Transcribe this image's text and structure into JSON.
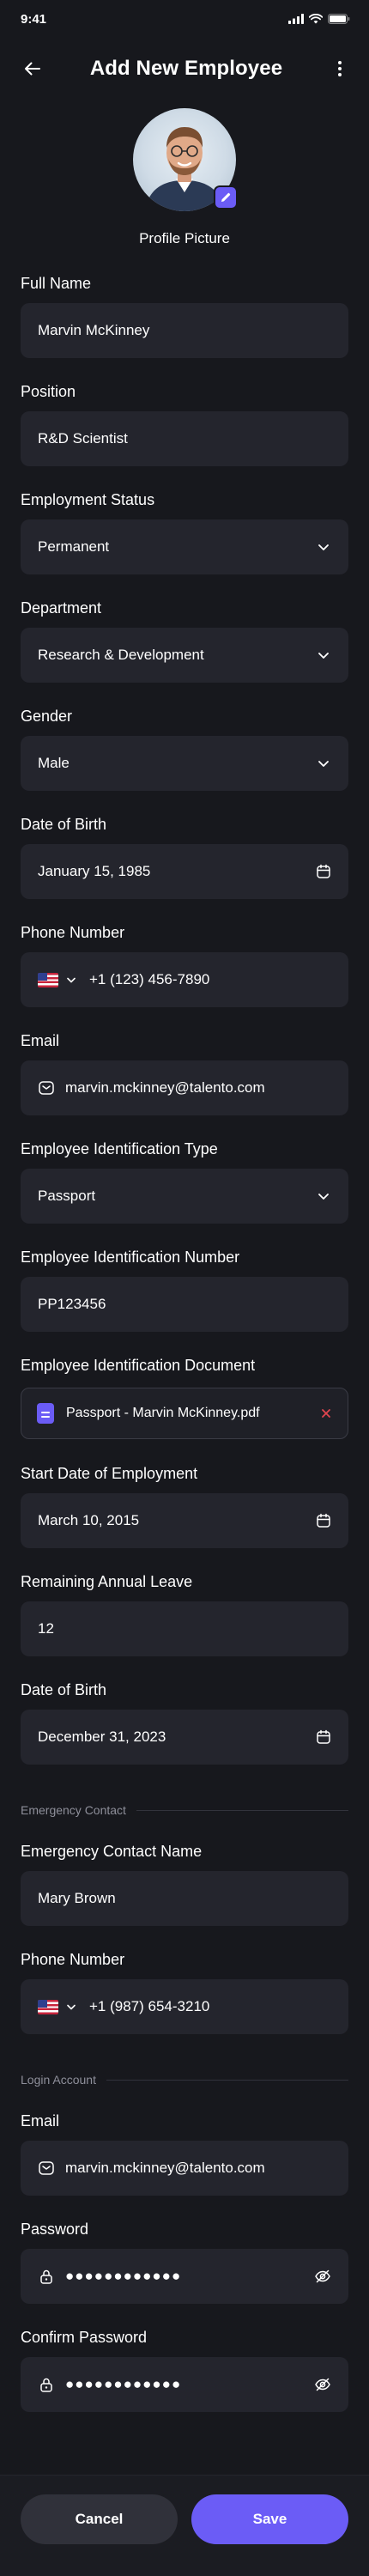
{
  "status_bar": {
    "time": "9:41"
  },
  "header": {
    "title": "Add New Employee"
  },
  "profile": {
    "caption": "Profile Picture"
  },
  "fields": {
    "full_name": {
      "label": "Full Name",
      "value": "Marvin McKinney"
    },
    "position": {
      "label": "Position",
      "value": "R&D Scientist"
    },
    "employment_status": {
      "label": "Employment Status",
      "value": "Permanent"
    },
    "department": {
      "label": "Department",
      "value": "Research & Development"
    },
    "gender": {
      "label": "Gender",
      "value": "Male"
    },
    "date_of_birth": {
      "label": "Date of Birth",
      "value": "January 15, 1985"
    },
    "phone": {
      "label": "Phone Number",
      "value": "+1 (123) 456-7890"
    },
    "email": {
      "label": "Email",
      "value": "marvin.mckinney@talento.com"
    },
    "id_type": {
      "label": "Employee Identification Type",
      "value": "Passport"
    },
    "id_number": {
      "label": "Employee Identification Number",
      "value": "PP123456"
    },
    "id_document": {
      "label": "Employee Identification Document",
      "value": "Passport - Marvin McKinney.pdf"
    },
    "start_date": {
      "label": "Start Date of Employment",
      "value": "March 10, 2015"
    },
    "annual_leave": {
      "label": "Remaining Annual Leave",
      "value": "12"
    },
    "date_of_birth_2": {
      "label": "Date of Birth",
      "value": "December 31, 2023"
    }
  },
  "emergency": {
    "section_title": "Emergency Contact",
    "name": {
      "label": "Emergency Contact Name",
      "value": "Mary Brown"
    },
    "phone": {
      "label": "Phone Number",
      "value": "+1 (987) 654-3210"
    }
  },
  "login": {
    "section_title": "Login Account",
    "email": {
      "label": "Email",
      "value": "marvin.mckinney@talento.com"
    },
    "password": {
      "label": "Password",
      "value": "●●●●●●●●●●●●"
    },
    "confirm_password": {
      "label": "Confirm Password",
      "value": "●●●●●●●●●●●●"
    }
  },
  "actions": {
    "cancel_label": "Cancel",
    "save_label": "Save"
  },
  "colors": {
    "background": "#17181d",
    "field": "#24252d",
    "accent": "#6b5cf6",
    "muted_text": "#8e8f9a",
    "remove_icon": "#e0454f"
  },
  "icons": {
    "back": "arrow-left-icon",
    "more": "more-vertical-icon",
    "edit": "pencil-icon",
    "dropdown": "chevron-down-icon",
    "calendar": "calendar-icon",
    "email": "mail-icon",
    "lock": "lock-icon",
    "visibility": "eye-off-icon",
    "document": "file-icon",
    "remove": "close-icon",
    "flag": "us-flag-icon"
  }
}
